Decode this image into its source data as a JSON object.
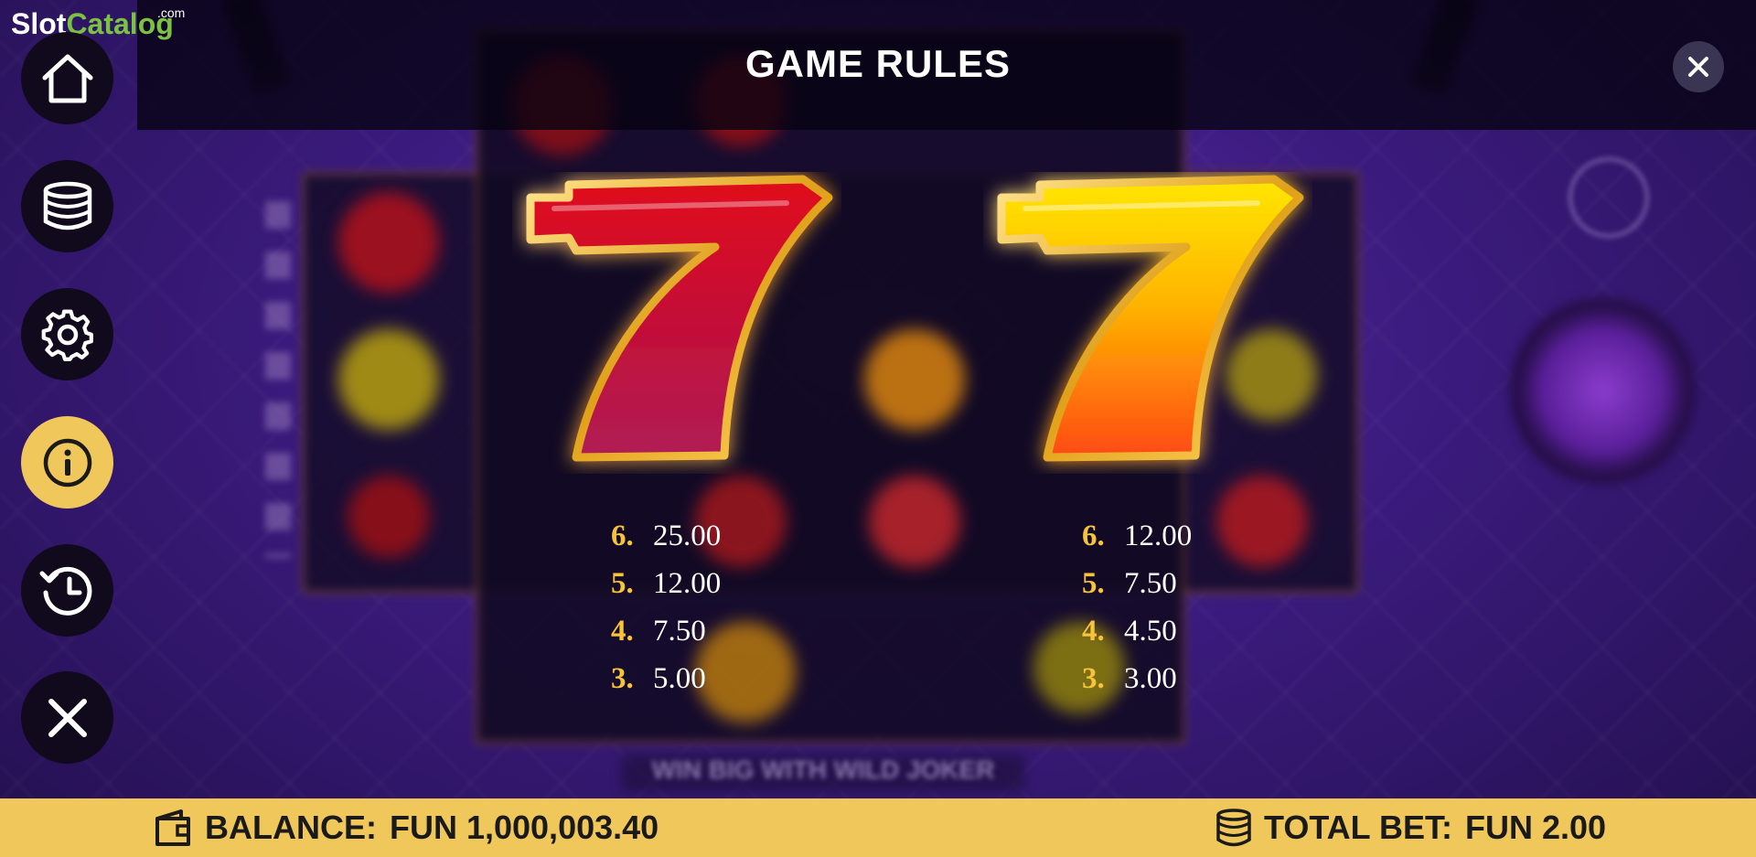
{
  "watermark": {
    "brand_slot": "Slot",
    "brand_catalog": "Catalog",
    "brand_tld": ".com"
  },
  "header": {
    "title": "GAME RULES",
    "close_icon": "close-icon"
  },
  "menu": [
    {
      "name": "home",
      "icon": "home-icon"
    },
    {
      "name": "bet",
      "icon": "coin-stack-icon"
    },
    {
      "name": "settings",
      "icon": "gear-icon"
    },
    {
      "name": "info",
      "icon": "info-icon",
      "active": true
    },
    {
      "name": "history",
      "icon": "history-icon"
    },
    {
      "name": "close",
      "icon": "close-icon"
    }
  ],
  "background": {
    "banner_text": "WIN BIG WITH WILD JOKER"
  },
  "paytables": [
    {
      "symbol": "red-seven-icon",
      "rows": [
        {
          "count": "6.",
          "value": "25.00"
        },
        {
          "count": "5.",
          "value": "12.00"
        },
        {
          "count": "4.",
          "value": "7.50"
        },
        {
          "count": "3.",
          "value": "5.00"
        }
      ]
    },
    {
      "symbol": "yellow-seven-icon",
      "rows": [
        {
          "count": "6.",
          "value": "12.00"
        },
        {
          "count": "5.",
          "value": "7.50"
        },
        {
          "count": "4.",
          "value": "4.50"
        },
        {
          "count": "3.",
          "value": "3.00"
        }
      ]
    }
  ],
  "footer": {
    "balance_label": "BALANCE:",
    "balance_value": "FUN 1,000,003.40",
    "total_bet_label": "TOTAL BET:",
    "total_bet_value": "FUN 2.00"
  },
  "colors": {
    "accent": "#f0c75a",
    "paycount": "#f6c33b",
    "header_bg": "#06030f"
  }
}
